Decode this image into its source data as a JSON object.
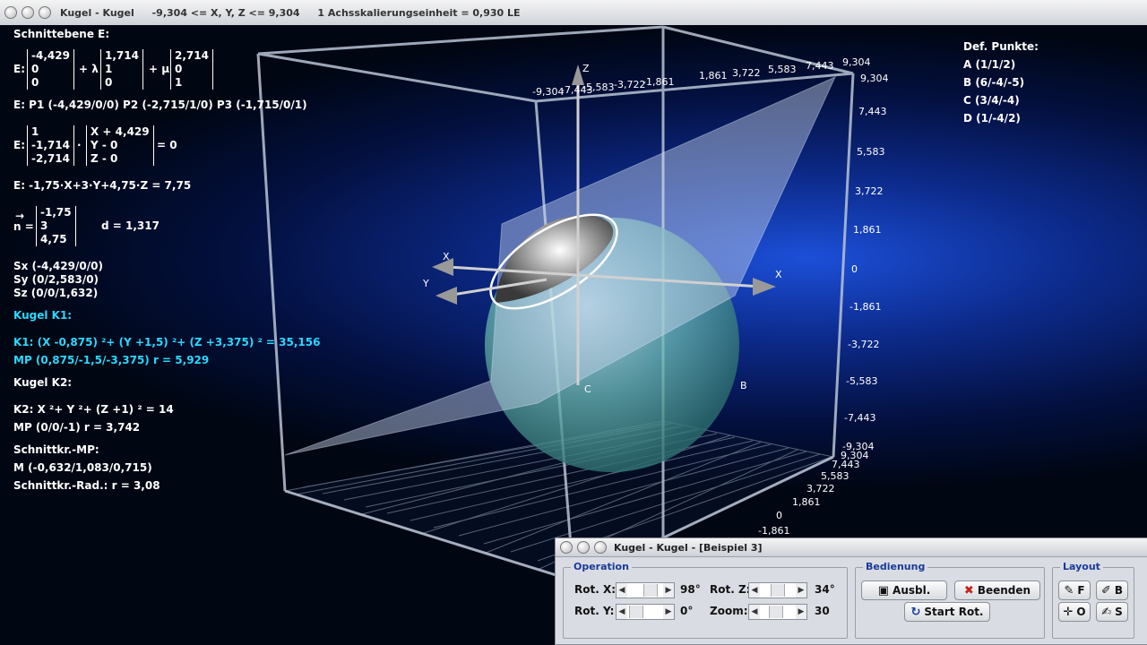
{
  "window": {
    "title": "Kugel - Kugel",
    "range": "-9,304 <= X, Y, Z <= 9,304",
    "scale": "1 Achsskalierungseinheit = 0,930 LE"
  },
  "info": {
    "heading": "Schnittebene E:",
    "e_prefix": "E:",
    "m1": [
      "-4,429",
      "0",
      "0"
    ],
    "plus_lambda": "+ λ",
    "m2": [
      "1,714",
      "1",
      "0"
    ],
    "plus_mu": "+ μ",
    "m3": [
      "2,714",
      "0",
      "1"
    ],
    "points_line": "E: P1 (-4,429/0/0)   P2 (-2,715/1/0)   P3 (-1,715/0/1)",
    "n_vec": [
      "1",
      "-1,714",
      "-2,714"
    ],
    "dot": "·",
    "x_vec": [
      "X + 4,429",
      "Y - 0",
      "Z - 0"
    ],
    "eq_zero": "= 0",
    "coord_eq": "E: -1,75·X+3·Y+4,75·Z = 7,75",
    "arrow": "→",
    "n_label": "n =",
    "normal": [
      "-1,75",
      "3",
      "4,75"
    ],
    "distance": "d = 1,317",
    "sx": "Sx (-4,429/0/0)",
    "sy": "Sy (0/2,583/0)",
    "sz": "Sz (0/0/1,632)",
    "k1_heading": "Kugel K1:",
    "k1_eq": "K1: (X -0,875) ²+ (Y +1,5) ²+ (Z +3,375) ² = 35,156",
    "k1_mp": "MP (0,875/-1,5/-3,375)  r = 5,929",
    "k2_heading": "Kugel K2:",
    "k2_eq": "K2: X ²+ Y ²+ (Z +1) ² = 14",
    "k2_mp": "MP (0/0/-1)  r = 3,742",
    "sk_heading": "Schnittkr.-MP:",
    "sk_m": "M (-0,632/1,083/0,715)",
    "sk_r": "Schnittkr.-Rad.: r = 3,08"
  },
  "def_points": {
    "heading": "Def. Punkte:",
    "items": [
      "A (1/1/2)",
      "B (6/-4/-5)",
      "C (3/4/-4)",
      "D (1/-4/2)"
    ]
  },
  "axes": {
    "x": "X",
    "y": "Y",
    "z": "Z",
    "point_b": "B",
    "point_c": "C",
    "right_ticks": [
      "9,304",
      "7,443",
      "5,583",
      "3,722",
      "1,861",
      "0",
      "-1,861",
      "-3,722",
      "-5,583",
      "-7,443",
      "-9,304"
    ],
    "top_ticks_left": [
      "-9,304",
      "-7,443",
      "-5,583",
      "-3,722",
      "-1,861"
    ],
    "top_ticks_right": [
      "1,861",
      "3,722",
      "5,583",
      "7,443",
      "9,304"
    ],
    "bottom_ticks": [
      "9,304",
      "7,443",
      "5,583",
      "3,722",
      "1,861",
      "0",
      "-1,861"
    ]
  },
  "panel": {
    "title": "Kugel - Kugel - [Beispiel 3]",
    "operation": "Operation",
    "rot_x": "Rot. X:",
    "rot_x_val": "98°",
    "rot_y": "Rot. Y:",
    "rot_y_val": "0°",
    "rot_z": "Rot. Z:",
    "rot_z_val": "34°",
    "zoom": "Zoom:",
    "zoom_val": "30",
    "bedienung": "Bedienung",
    "ausbl": "Ausbl.",
    "beenden": "Beenden",
    "start_rot": "Start Rot.",
    "layout": "Layout",
    "f": "F",
    "b": "B",
    "o": "O",
    "s": "S"
  },
  "colors": {
    "accent": "#2ad8ff",
    "background": "#0c2a8a"
  }
}
